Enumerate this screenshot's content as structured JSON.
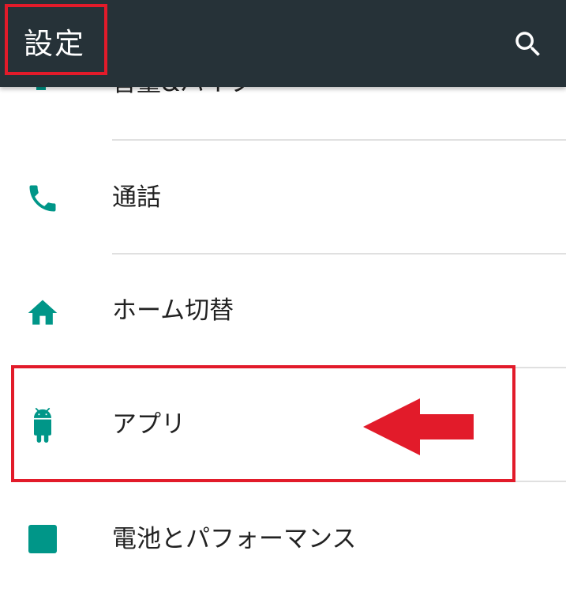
{
  "toolbar": {
    "title": "設定",
    "search_icon": "search-icon",
    "background_color": "#263238"
  },
  "settings_list": {
    "items": [
      {
        "label": "音量&バイブ",
        "icon": "volume-vibrate-icon"
      },
      {
        "label": "通話",
        "icon": "phone-icon"
      },
      {
        "label": "ホーム切替",
        "icon": "home-icon"
      },
      {
        "label": "アプリ",
        "icon": "android-icon"
      },
      {
        "label": "電池とパフォーマンス",
        "icon": "battery-icon"
      }
    ]
  },
  "colors": {
    "icon_accent": "#009688",
    "annotation_red": "#e21b2a"
  }
}
